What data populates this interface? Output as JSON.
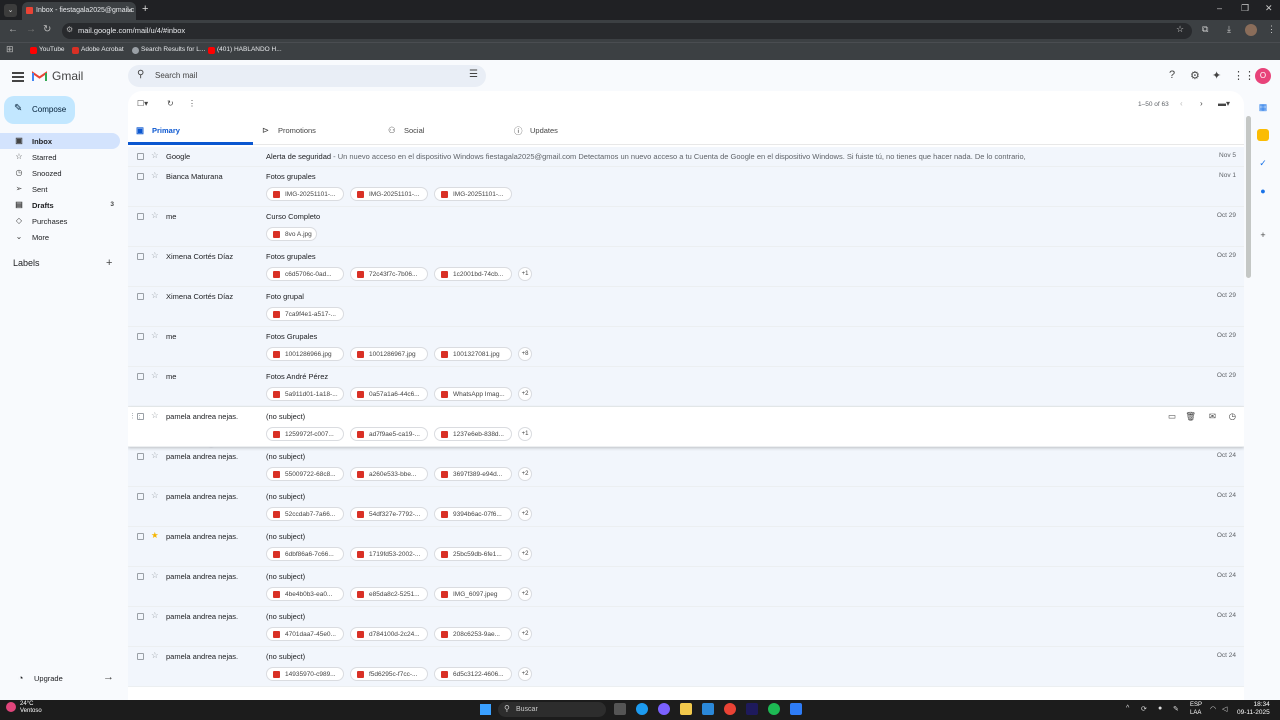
{
  "browser": {
    "tab_title": "Inbox - fiestagala2025@gmail.c",
    "url": "mail.google.com/mail/u/4/#inbox",
    "bookmarks": [
      {
        "label": "YouTube",
        "color": "#ff0000"
      },
      {
        "label": "Adobe Acrobat",
        "color": "#d93025"
      },
      {
        "label": "Search Results for L...",
        "color": "#9aa0a6"
      },
      {
        "label": "(401) HABLANDO H...",
        "color": "#ff0000"
      }
    ]
  },
  "gmail": {
    "logo": "Gmail",
    "search_placeholder": "Search mail",
    "compose_label": "Compose",
    "nav": [
      {
        "label": "Inbox",
        "icon": "inbox-icon",
        "count": ""
      },
      {
        "label": "Starred",
        "icon": "star-icon",
        "count": ""
      },
      {
        "label": "Snoozed",
        "icon": "clock-icon",
        "count": ""
      },
      {
        "label": "Sent",
        "icon": "send-icon",
        "count": ""
      },
      {
        "label": "Drafts",
        "icon": "draft-icon",
        "count": "3"
      },
      {
        "label": "Purchases",
        "icon": "tag-icon",
        "count": ""
      },
      {
        "label": "More",
        "icon": "chevron-down-icon",
        "count": ""
      }
    ],
    "labels_heading": "Labels",
    "upgrade_label": "Upgrade",
    "avatar_letter": "O",
    "pager": "1–50 of 63",
    "tabs": [
      {
        "label": "Primary",
        "icon": "inbox-icon"
      },
      {
        "label": "Promotions",
        "icon": "tag-icon"
      },
      {
        "label": "Social",
        "icon": "people-icon"
      },
      {
        "label": "Updates",
        "icon": "info-icon"
      }
    ],
    "emails": [
      {
        "sender": "Google",
        "subject": "Alerta de seguridad",
        "snippet": " - Un nuevo acceso en el dispositivo Windows fiestagala2025@gmail.com Detectamos un nuevo acceso a tu Cuenta de Google en el dispositivo Windows. Si fuiste tú, no tienes que hacer nada. De lo contrario,",
        "date": "Nov 5",
        "starred": false,
        "attachments": [],
        "more": ""
      },
      {
        "sender": "Bianca Maturana",
        "subject": "Fotos grupales",
        "snippet": "",
        "date": "Nov 1",
        "starred": false,
        "attachments": [
          "IMG-20251101-...",
          "IMG-20251101-...",
          "IMG-20251101-..."
        ],
        "more": ""
      },
      {
        "sender": "me",
        "subject": "Curso Completo",
        "snippet": "",
        "date": "Oct 29",
        "starred": false,
        "attachments": [
          "8vo A.jpg"
        ],
        "more": ""
      },
      {
        "sender": "Ximena Cortés Díaz",
        "subject": "Fotos grupales",
        "snippet": "",
        "date": "Oct 29",
        "starred": false,
        "attachments": [
          "c6d5706c-0ad...",
          "72c43f7c-7b06...",
          "1c2001bd-74cb..."
        ],
        "more": "+1"
      },
      {
        "sender": "Ximena Cortés Díaz",
        "subject": "Foto grupal",
        "snippet": "",
        "date": "Oct 29",
        "starred": false,
        "attachments": [
          "7ca9f4e1-a517-..."
        ],
        "more": ""
      },
      {
        "sender": "me",
        "subject": "Fotos Grupales",
        "snippet": "",
        "date": "Oct 29",
        "starred": false,
        "attachments": [
          "1001286966.jpg",
          "1001286967.jpg",
          "1001327081.jpg"
        ],
        "more": "+8"
      },
      {
        "sender": "me",
        "subject": "Fotos André Pérez",
        "snippet": "",
        "date": "Oct 29",
        "starred": false,
        "attachments": [
          "5a911d01-1a18-...",
          "0a57a1a6-44c6...",
          "WhatsApp Imag..."
        ],
        "more": "+2"
      },
      {
        "sender": "pamela andrea nejas.",
        "subject": "(no subject)",
        "snippet": "",
        "date": "",
        "starred": false,
        "attachments": [
          "1259972f-c007...",
          "ad7f9ae5-ca19-...",
          "1237e6eb-838d..."
        ],
        "more": "+1",
        "hover": true
      },
      {
        "sender": "pamela andrea nejas.",
        "subject": "(no subject)",
        "snippet": "",
        "date": "Oct 24",
        "starred": false,
        "attachments": [
          "55009722-68c8...",
          "a260e533-bbe...",
          "3697f389-e94d..."
        ],
        "more": "+2"
      },
      {
        "sender": "pamela andrea nejas.",
        "subject": "(no subject)",
        "snippet": "",
        "date": "Oct 24",
        "starred": false,
        "attachments": [
          "52ccdab7-7a66...",
          "54df327e-7792-...",
          "9394b6ac-07f6..."
        ],
        "more": "+2"
      },
      {
        "sender": "pamela andrea nejas.",
        "subject": "(no subject)",
        "snippet": "",
        "date": "Oct 24",
        "starred": true,
        "attachments": [
          "6dbf86a6-7c66...",
          "1719fd53-2002-...",
          "25bc59db-6fe1..."
        ],
        "more": "+2"
      },
      {
        "sender": "pamela andrea nejas.",
        "subject": "(no subject)",
        "snippet": "",
        "date": "Oct 24",
        "starred": false,
        "attachments": [
          "4be4b0b3-ea0...",
          "e85da8c2-5251...",
          "IMG_6097.jpeg"
        ],
        "more": "+2"
      },
      {
        "sender": "pamela andrea nejas.",
        "subject": "(no subject)",
        "snippet": "",
        "date": "Oct 24",
        "starred": false,
        "attachments": [
          "4701daa7-45e0...",
          "d784100d-2c24...",
          "208c6253-9ae..."
        ],
        "more": "+2"
      },
      {
        "sender": "pamela andrea nejas.",
        "subject": "(no subject)",
        "snippet": "",
        "date": "Oct 24",
        "starred": false,
        "attachments": [
          "14935970-c989...",
          "f5d6295c-f7cc-...",
          "6d5c3122-4606..."
        ],
        "more": "+2"
      }
    ]
  },
  "taskbar": {
    "temp": "24°C",
    "weather": "Ventoso",
    "search": "Buscar",
    "lang1": "ESP",
    "lang2": "LAA",
    "time": "18:34",
    "date": "09-11-2025"
  },
  "colors": {
    "accent": "#0b57d0",
    "compose_bg": "#c2e7ff",
    "active_nav": "#d3e3fd",
    "pdf_red": "#d93025"
  }
}
